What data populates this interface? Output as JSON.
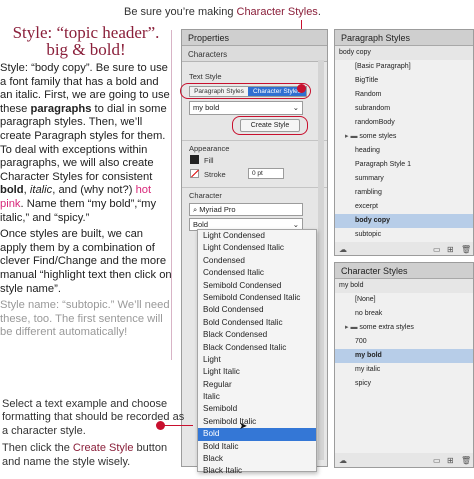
{
  "top_note": {
    "prefix": "Be sure you’re making ",
    "highlight": "Character Styles",
    "suffix": "."
  },
  "left": {
    "heading": "Style: “topic header”. big & bold!",
    "p1_a": "Style: “body copy”. Be sure to use a font family that has a bold and an italic. First, we are going to use these ",
    "p1_bold": "paragraphs",
    "p1_b": " to dial in some paragraph styles. Then, we’ll create Paragraph styles for them. To deal with exceptions within paragraphs, we will also create Character Styles for consistent ",
    "p1_bold2": "bold",
    "p1_c": ", ",
    "p1_italic": "italic",
    "p1_d": ", and (why not?) ",
    "p1_pink": "hot pink",
    "p1_e": ". Name them “my bold”,“my italic,” and “spicy.”",
    "p2": "Once styles are built, we can apply them by a combination of clever Find/Change and the more manual “highlight text then click on style name”.",
    "p3": "Style name: “subtopic.” We’ll need these, too. The first sentence will be different automatically!"
  },
  "bottom_note": {
    "line1": "Select a text example and choose formatting that should be recorded as a character style.",
    "line2_prefix": "Then click the ",
    "line2_highlight": "Create Style",
    "line2_suffix": " button and name the style wisely."
  },
  "properties": {
    "title": "Properties",
    "tab": "Characters",
    "text_style_label": "Text Style",
    "seg_para": "Paragraph Styles",
    "seg_char": "Character Styles",
    "style_value": "my bold",
    "create_style": "Create Style",
    "appearance_label": "Appearance",
    "fill_label": "Fill",
    "stroke_label": "Stroke",
    "stroke_value": "0 pt",
    "character_label": "Character",
    "font_family": "Myriad Pro",
    "font_style": "Bold"
  },
  "font_styles": [
    "Light Condensed",
    "Light Condensed Italic",
    "Condensed",
    "Condensed Italic",
    "Semibold Condensed",
    "Semibold Condensed Italic",
    "Bold Condensed",
    "Bold Condensed Italic",
    "Black Condensed",
    "Black Condensed Italic",
    "Light",
    "Light Italic",
    "Regular",
    "Italic",
    "Semibold",
    "Semibold Italic",
    "Bold",
    "Bold Italic",
    "Black",
    "Black Italic"
  ],
  "selected_font_style": "Bold",
  "paragraph_styles": {
    "title": "Paragraph Styles",
    "current": "body copy",
    "items": [
      "[Basic Paragraph]",
      "BigTitle",
      "Random",
      "subrandom",
      "randomBody",
      "some styles",
      "heading",
      "Paragraph Style 1",
      "summary",
      "rambling",
      "excerpt",
      "body copy",
      "subtopic"
    ],
    "selected": "body copy"
  },
  "character_styles": {
    "title": "Character Styles",
    "current": "my bold",
    "items": [
      "[None]",
      "no break",
      "some extra styles",
      "700",
      "my bold",
      "my italic",
      "spicy"
    ],
    "selected": "my bold"
  }
}
